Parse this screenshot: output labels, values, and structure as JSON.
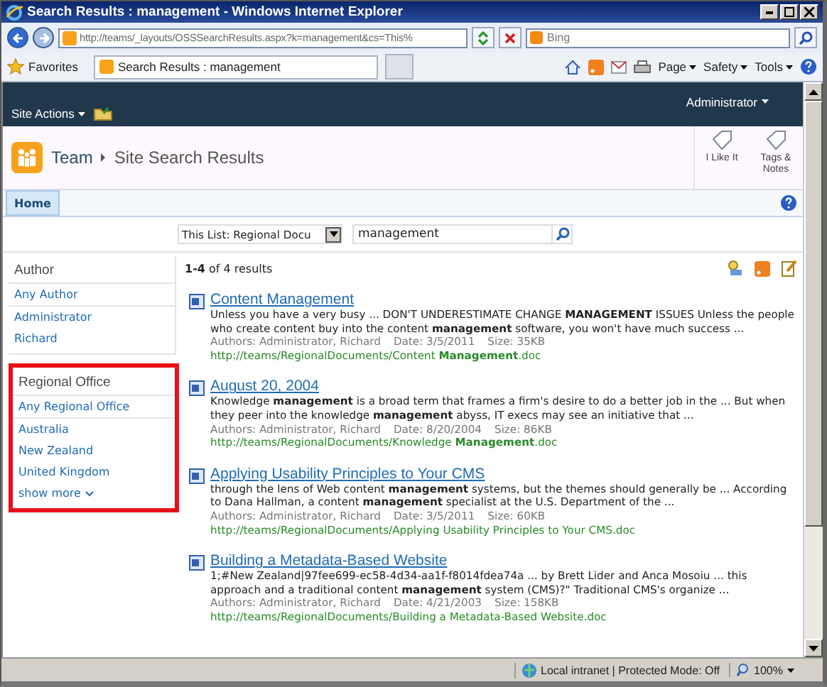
{
  "window": {
    "title": "Search Results : management - Windows Internet Explorer"
  },
  "browser": {
    "address": "http://teams/_layouts/OSSSearchResults.aspx?k=management&cs=This%",
    "search_placeholder": "Bing",
    "favorites": "Favorites",
    "tabs": [
      {
        "label": "Search Results : management",
        "selected": true
      }
    ],
    "commands": [
      "Page",
      "Safety",
      "Tools"
    ]
  },
  "top_bar": {
    "site_actions": "Site Actions",
    "user": "Administrator"
  },
  "header": {
    "breadcrumb": [
      "Team",
      "Site Search Results"
    ],
    "actions": [
      "I Like It",
      "Tags & Notes"
    ]
  },
  "nav": [
    {
      "label": "Home",
      "selected": true
    }
  ],
  "search": {
    "scope": "This List: Regional Docu",
    "query": "management"
  },
  "refiners": [
    {
      "heading": "Author",
      "highlighted": false,
      "items": [
        {
          "label": "Any Author",
          "selected": true
        },
        {
          "label": "Administrator",
          "selected": false
        },
        {
          "label": "Richard",
          "selected": false
        }
      ]
    },
    {
      "heading": "Regional Office",
      "highlighted": true,
      "items": [
        {
          "label": "Any Regional Office",
          "selected": true
        },
        {
          "label": "Australia",
          "selected": false
        },
        {
          "label": "New Zealand",
          "selected": false
        },
        {
          "label": "United Kingdom",
          "selected": false
        }
      ],
      "more": "show more"
    }
  ],
  "results_count": "**1-4** of 4 results",
  "results": [
    {
      "title": "Content Management",
      "snippet": "Unless you have a very busy ... DON'T UNDERESTIMATE CHANGE **MANAGEMENT** ISSUES Unless the people who create content buy into the content **management** software, you won't have much success ...",
      "authors": "Authors: Administrator, Richard",
      "date": "Date: 3/5/2011",
      "size": "Size: 35KB",
      "url": "http://teams/RegionalDocuments/Content **Management**.doc"
    },
    {
      "title": "August 20, 2004",
      "snippet": "Knowledge **management** is a broad term that frames a firm's desire to do a better job in the ... But when they peer into the knowledge **management** abyss, IT execs may see an initiative that ...",
      "authors": "Authors: Administrator, Richard",
      "date": "Date: 8/20/2004",
      "size": "Size: 86KB",
      "url": "http://teams/RegionalDocuments/Knowledge **Management**.doc"
    },
    {
      "title": "Applying Usability Principles to Your CMS",
      "snippet": "through the lens of Web content **management** systems, but the themes should generally be ... According to Dana Hallman, a content **management** specialist at the U.S. Department of the ...",
      "authors": "Authors: Administrator, Richard",
      "date": "Date: 3/5/2011",
      "size": "Size: 60KB",
      "url": "http://teams/RegionalDocuments/Applying Usability Principles to Your CMS.doc"
    },
    {
      "title": "Building a Metadata-Based Website",
      "snippet": "1;#New Zealand|97fee699-ec58-4d34-aa1f-f8014fdea74a ... by Brett Lider and Anca Mosoiu ... this approach and a traditional content **management** system (CMS)?\" Traditional CMS's organize ...",
      "authors": "Authors: Administrator, Richard",
      "date": "Date: 4/21/2003",
      "size": "Size: 158KB",
      "url": "http://teams/RegionalDocuments/Building a Metadata-Based Website.doc"
    }
  ],
  "status_bar": {
    "zone": "Local intranet | Protected Mode: Off",
    "zoom": "100%"
  }
}
